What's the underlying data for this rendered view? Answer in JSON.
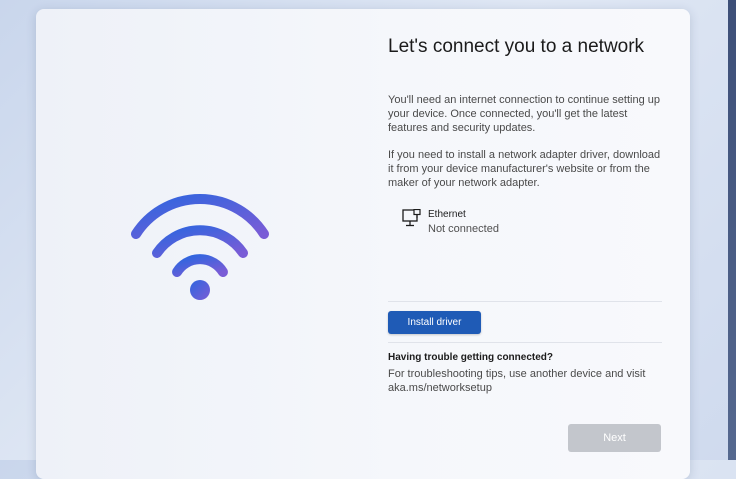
{
  "page": {
    "title": "Let's connect you to a network",
    "description_1": "You'll need an internet connection to continue setting up your device. Once connected, you'll get the latest features and security updates.",
    "description_2": "If you need to install a network adapter driver, download it from your device manufacturer's website or from the maker of your network adapter."
  },
  "network": {
    "icon": "ethernet-icon",
    "name": "Ethernet",
    "status": "Not connected"
  },
  "actions": {
    "install_driver_label": "Install driver",
    "next_label": "Next"
  },
  "help": {
    "title": "Having trouble getting connected?",
    "text": "For troubleshooting tips, use another device and visit aka.ms/networksetup"
  },
  "illustration": {
    "icon": "wifi-icon"
  },
  "colors": {
    "primary_button": "#1f5bb6",
    "disabled_button": "#c3c6cc",
    "wifi_gradient_start": "#2f66df",
    "wifi_gradient_end": "#7a5cd6"
  }
}
